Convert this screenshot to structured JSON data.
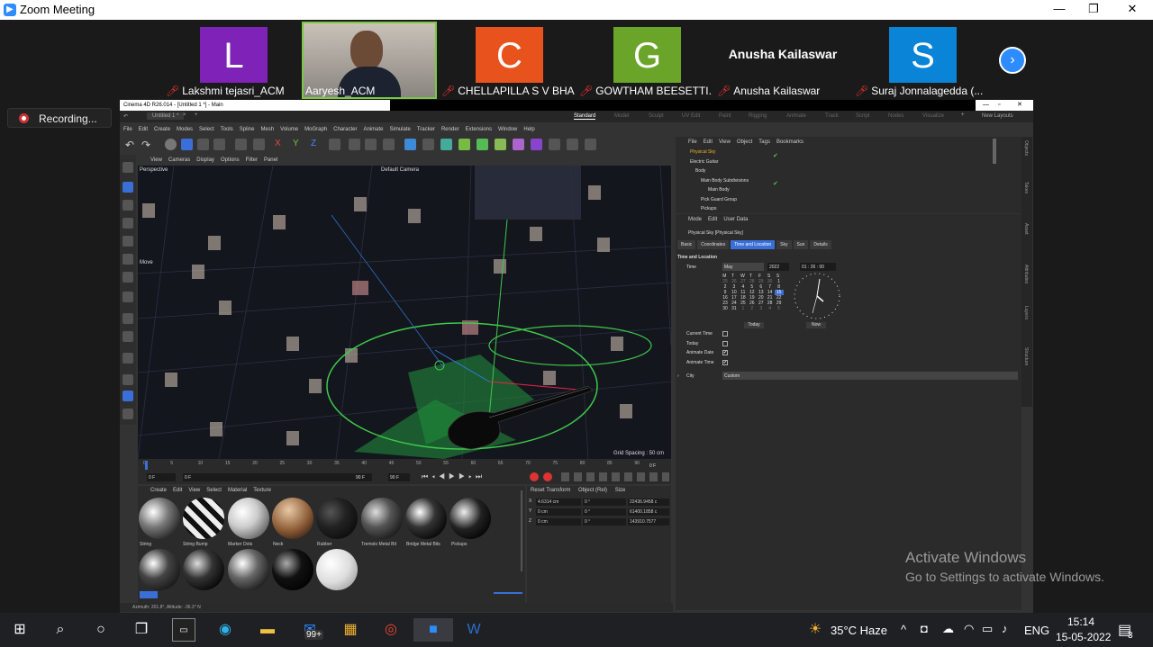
{
  "zoom": {
    "title": "Zoom Meeting",
    "controls": [
      "—",
      "❐",
      "✕"
    ],
    "recording": "Recording...",
    "participants": [
      {
        "initial": "L",
        "name": "Lakshmi tejasri_ACM",
        "color": "#7e22b8",
        "muted": true
      },
      {
        "initial": "",
        "name": "Aaryesh_ACM",
        "color": "#4a6a7a",
        "muted": false,
        "video": true
      },
      {
        "initial": "C",
        "name": "CHELLAPILLA S V BHA...",
        "color": "#e8521c",
        "muted": true
      },
      {
        "initial": "G",
        "name": "GOWTHAM BEESETTI...",
        "color": "#6aa428",
        "muted": true
      },
      {
        "initial": "",
        "name": "Anusha Kailaswar",
        "display": "Anusha Kailaswar",
        "color": "#1a1a1a",
        "muted": true
      },
      {
        "initial": "S",
        "name": "Suraj Jonnalagedda (...",
        "color": "#0a84d6",
        "muted": true
      }
    ],
    "next_icon": "›"
  },
  "c4d": {
    "title": "Cinema 4D R26.014 - [Untitled 1 *] - Main",
    "tab": "Untitled 1 *",
    "layouts": [
      "Standard",
      "Model",
      "Sculpt",
      "UV Edit",
      "Paint",
      "Rigging",
      "Animate",
      "Track",
      "Script",
      "Nodes",
      "Visualize"
    ],
    "new_layouts": "New Layouts",
    "menu": [
      "File",
      "Edit",
      "Create",
      "Modes",
      "Select",
      "Tools",
      "Spline",
      "Mesh",
      "Volume",
      "MoGraph",
      "Character",
      "Animate",
      "Simulate",
      "Tracker",
      "Render",
      "Extensions",
      "Window",
      "Help"
    ],
    "viewport_menu": [
      "View",
      "Cameras",
      "Display",
      "Options",
      "Filter",
      "Panel"
    ],
    "viewport_label": "Perspective",
    "camera_label": "Default Camera",
    "move_label": "Move",
    "grid_spacing": "Grid Spacing : 50 cm",
    "timeline_ticks": [
      "0",
      "5",
      "10",
      "15",
      "20",
      "25",
      "30",
      "35",
      "40",
      "45",
      "50",
      "55",
      "60",
      "65",
      "70",
      "75",
      "80",
      "85",
      "90"
    ],
    "frame_start": "0 F",
    "frame_cur": "0 F",
    "frame_end": "90 F",
    "frame_end2": "90 F",
    "frame_right": "0 F",
    "materials_menu": [
      "Create",
      "Edit",
      "View",
      "Select",
      "Material",
      "Texture"
    ],
    "materials": [
      "String",
      "String Bump",
      "Marker Dots",
      "Neck",
      "Rubber",
      "Tremolo Metal Bit",
      "Bridge Metal Bits",
      "Pickups"
    ],
    "coords_menu": [
      "Reset Transform",
      "Object (Rel)",
      "Size"
    ],
    "coords": [
      {
        "axis": "X",
        "pos": "4.6314 cm",
        "rot": "0 °",
        "size": "22436.9458 c"
      },
      {
        "axis": "Y",
        "pos": "0 cm",
        "rot": "0 °",
        "size": "61400.1858 c"
      },
      {
        "axis": "Z",
        "pos": "0 cm",
        "rot": "0 °",
        "size": "143910.7577"
      }
    ],
    "obj_menu": [
      "File",
      "Edit",
      "View",
      "Object",
      "Tags",
      "Bookmarks"
    ],
    "objects": [
      "Physical Sky",
      "Electric Guitar",
      "Body",
      "Main Body Subdivisions",
      "Main Body",
      "Pick Guard Group",
      "Pickups"
    ],
    "attr_menu": [
      "Mode",
      "Edit",
      "User Data"
    ],
    "attr_title": "Physical Sky [Physical Sky]",
    "attr_tabs": [
      "Basic",
      "Coordinates",
      "Time and Location",
      "Sky",
      "Sun",
      "Details"
    ],
    "section": "Time and Location",
    "time_label": "Time",
    "month": "May",
    "year": "2022",
    "time_value": "01 : 26 : 00",
    "weekdays": [
      "M",
      "T",
      "W",
      "T",
      "F",
      "S",
      "S"
    ],
    "cal_rows": [
      [
        "25",
        "26",
        "27",
        "28",
        "29",
        "30",
        "1"
      ],
      [
        "2",
        "3",
        "4",
        "5",
        "6",
        "7",
        "8"
      ],
      [
        "9",
        "10",
        "11",
        "12",
        "13",
        "14",
        "15"
      ],
      [
        "16",
        "17",
        "18",
        "19",
        "20",
        "21",
        "22"
      ],
      [
        "23",
        "24",
        "25",
        "26",
        "27",
        "28",
        "29"
      ],
      [
        "30",
        "31",
        "1",
        "2",
        "3",
        "4",
        "5"
      ]
    ],
    "today_btn": "Today",
    "now_btn": "Now",
    "checks": [
      {
        "label": "Current Time",
        "checked": false
      },
      {
        "label": "Today",
        "checked": false
      },
      {
        "label": "Animate Date",
        "checked": true
      },
      {
        "label": "Animate Time",
        "checked": true
      }
    ],
    "city_label": "City",
    "city_value": "Custom",
    "side_tabs": [
      "Objects",
      "Takes",
      "Asset",
      "Attributes",
      "Layers",
      "Structure"
    ],
    "status": "Azimuth: 201.8°, Altitude: -36.3°  N"
  },
  "watermark": {
    "line1": "Activate Windows",
    "line2": "Go to Settings to activate Windows."
  },
  "taskbar": {
    "weather": "35°C  Haze",
    "lang": "ENG",
    "time": "15:14",
    "date": "15-05-2022",
    "mail_badge": "99+",
    "notif_count": "3"
  }
}
